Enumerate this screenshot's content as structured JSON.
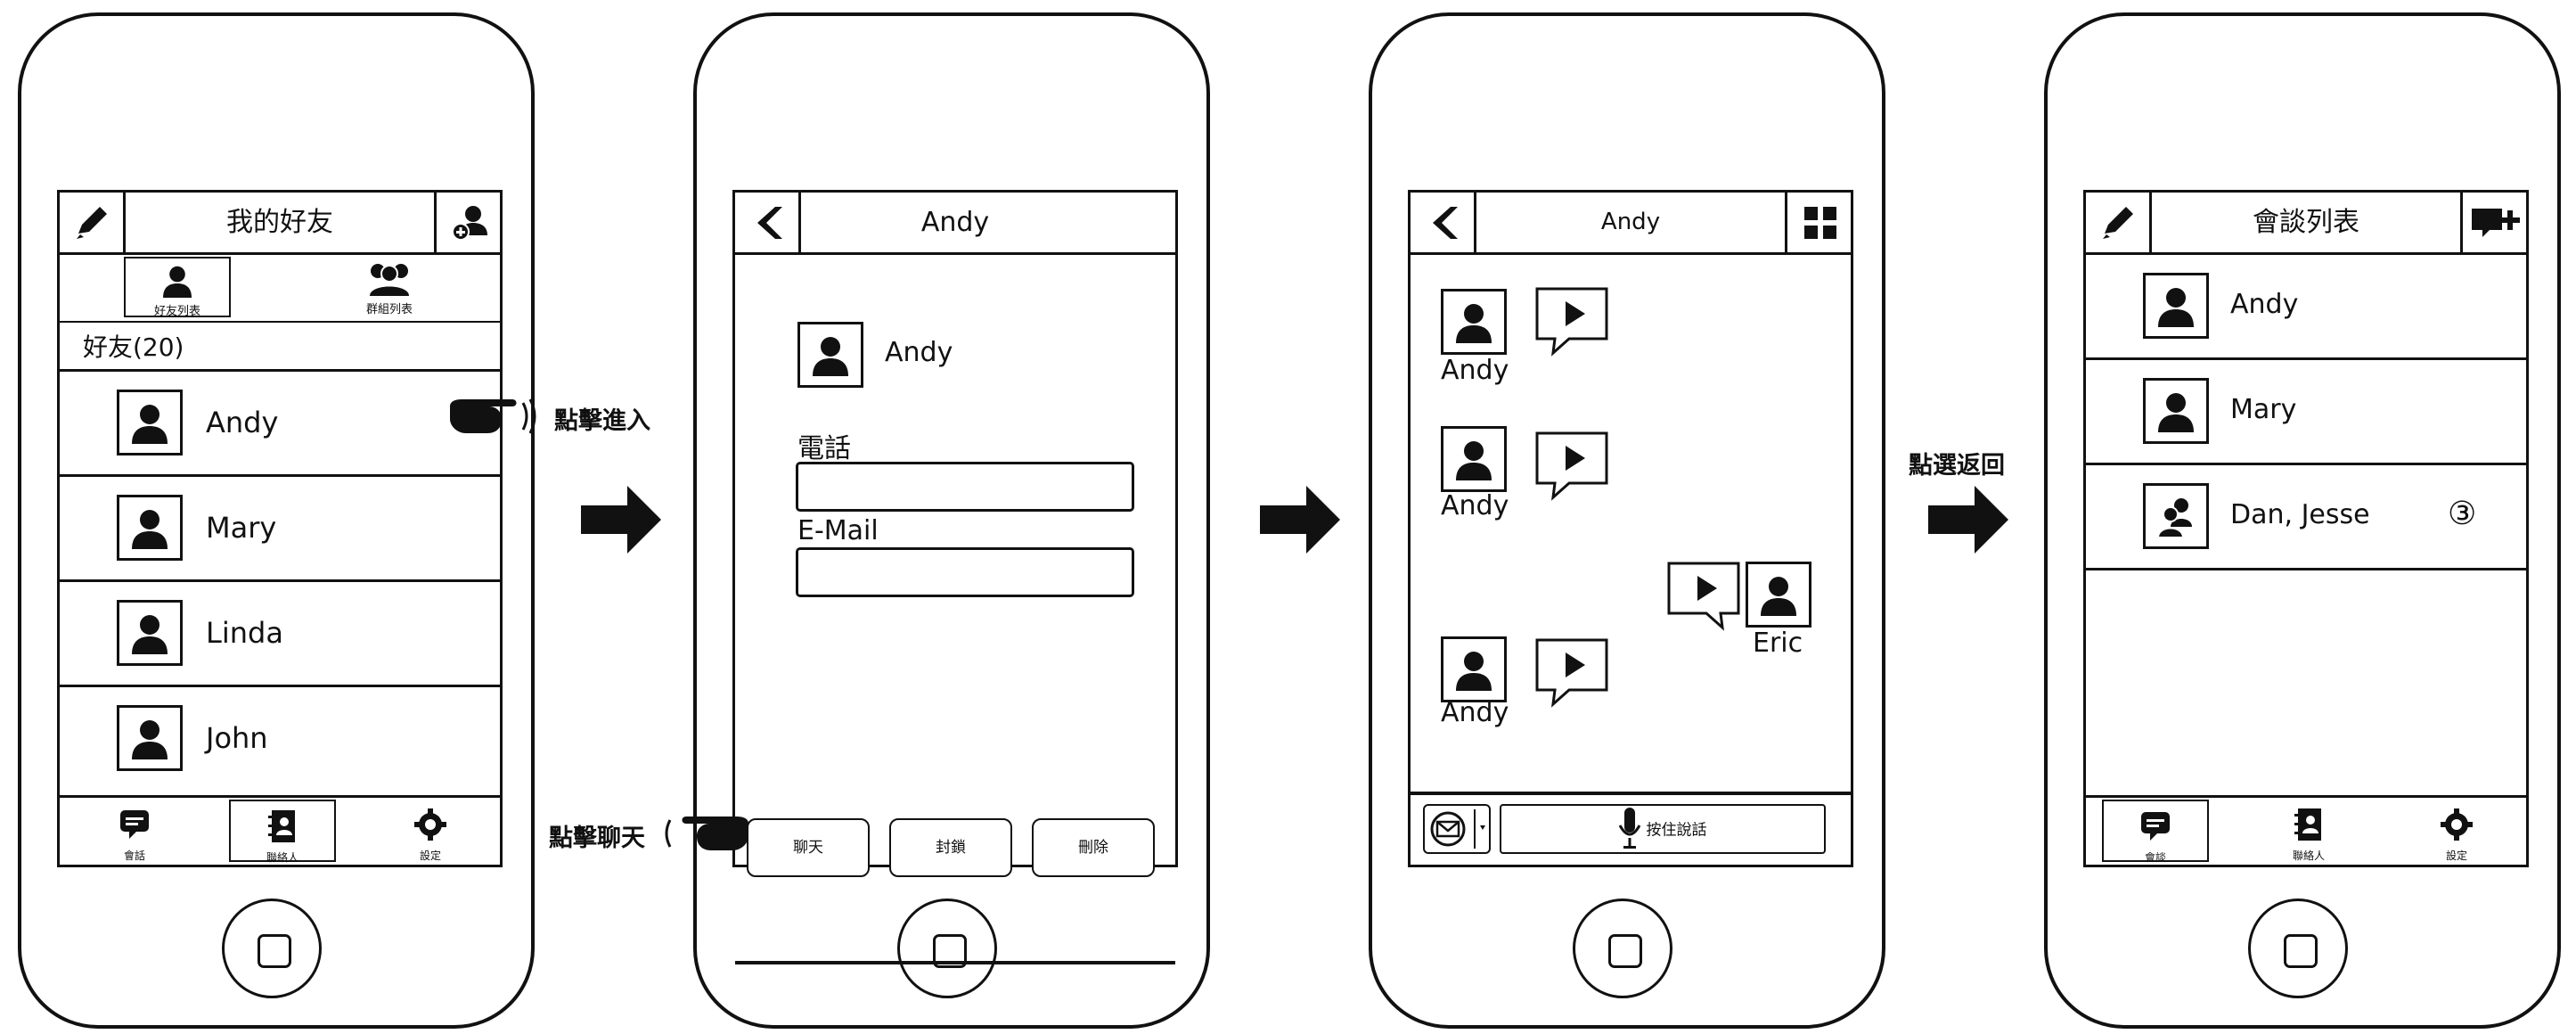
{
  "screen1": {
    "title": "我的好友",
    "tabs": [
      "好友列表",
      "群組列表"
    ],
    "count_label": "好友(20)",
    "contacts": [
      "Andy",
      "Mary",
      "Linda",
      "John"
    ],
    "bottom_tabs": [
      "會話",
      "聯絡人",
      "設定"
    ]
  },
  "annot_tap_enter": "點擊進入",
  "screen2": {
    "title": "Andy",
    "name": "Andy",
    "phone_label": "電話",
    "phone_value": "",
    "email_label": "E-Mail",
    "email_value": "",
    "buttons": [
      "聊天",
      "封鎖",
      "刪除"
    ]
  },
  "annot_tap_chat": "點擊聊天",
  "screen3": {
    "title": "Andy",
    "messages": [
      {
        "speaker": "Andy",
        "side": "left"
      },
      {
        "speaker": "Andy",
        "side": "left"
      },
      {
        "speaker": "Eric",
        "side": "right"
      },
      {
        "speaker": "Andy",
        "side": "left"
      }
    ],
    "push_to_talk": "按住說話"
  },
  "annot_tap_back": "點選返回",
  "screen4": {
    "title": "會談列表",
    "conversations": [
      {
        "name": "Andy",
        "badge": ""
      },
      {
        "name": "Mary",
        "badge": ""
      },
      {
        "name": "Dan, Jesse",
        "badge": "③"
      }
    ],
    "bottom_tabs": [
      "會談",
      "聯絡人",
      "設定"
    ]
  },
  "icons": [
    "pencil-icon",
    "add-user-icon",
    "user-icon",
    "group-icon",
    "chat-icon",
    "contacts-icon",
    "gear-icon",
    "back-chevron-icon",
    "grid-icon",
    "play-icon",
    "mic-icon",
    "compose-icon",
    "pointing-hand-icon",
    "right-arrow-icon"
  ]
}
